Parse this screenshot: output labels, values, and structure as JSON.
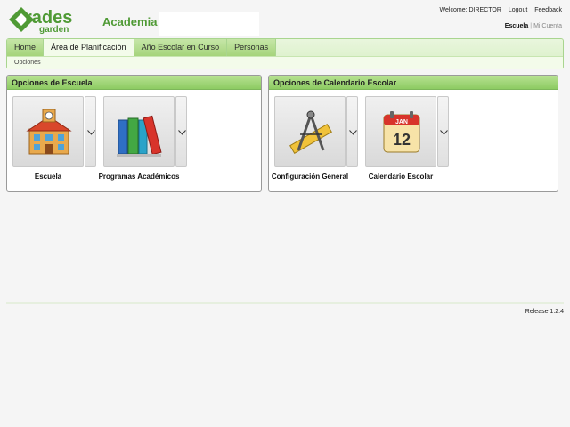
{
  "header": {
    "school_name": "Academia",
    "welcome": "Welcome: DIRECTOR",
    "logout": "Logout",
    "feedback": "Feedback",
    "escuela_link": "Escuela",
    "separator": "|",
    "cuenta_link": "Mi Cuenta"
  },
  "nav": {
    "tabs": [
      {
        "label": "Home"
      },
      {
        "label": "Área de Planificación"
      },
      {
        "label": "Año Escolar en Curso"
      },
      {
        "label": "Personas"
      }
    ],
    "active_tab": "Área de Planificación",
    "subnav": {
      "label": "Opciones"
    }
  },
  "panels": {
    "escuela": {
      "title": "Opciones de Escuela",
      "tiles": [
        {
          "label": "Escuela",
          "icon": "school-building-icon"
        },
        {
          "label": "Programas Académicos",
          "icon": "books-icon"
        }
      ]
    },
    "calendario": {
      "title": "Opciones de Calendario Escolar",
      "tiles": [
        {
          "label": "Configuración General",
          "icon": "drafting-tools-icon"
        },
        {
          "label": "Calendario Escolar",
          "icon": "calendar-icon",
          "calendar_month": "JAN",
          "calendar_day": "12"
        }
      ]
    }
  },
  "footer": {
    "release": "Release 1.2.4"
  },
  "colors": {
    "brand_green": "#4f9a35",
    "header_green": "#8dcb62",
    "tab_green": "#a5d47b"
  }
}
